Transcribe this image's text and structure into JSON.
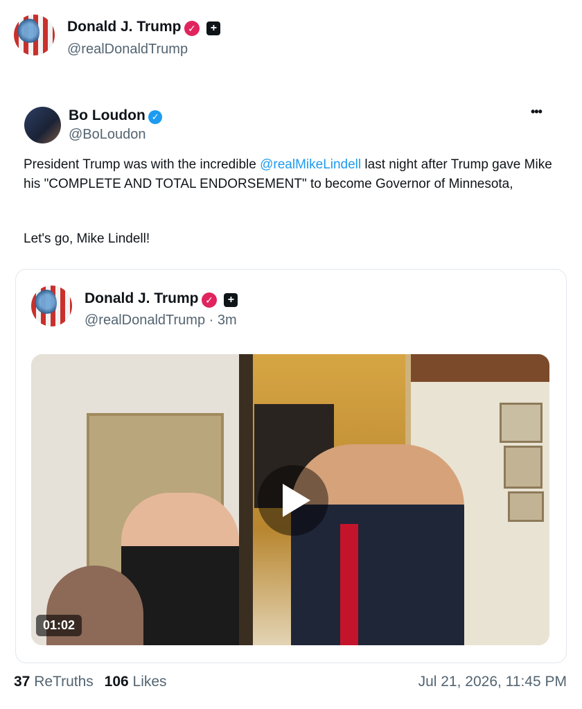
{
  "author": {
    "name": "Donald J. Trump",
    "handle": "@realDonaldTrump"
  },
  "retruth": {
    "name": "Bo Loudon",
    "handle": "@BoLoudon",
    "menu_icon": "•••",
    "text_before": "President Trump was with the incredible ",
    "mention": "@realMikeLindell",
    "text_after": " last night after Trump gave Mike his \"COMPLETE AND TOTAL ENDORSEMENT\" to become Governor of Minnesota,",
    "text_line2": "Let's go, Mike Lindell!"
  },
  "quoted": {
    "name": "Donald J. Trump",
    "handle_time": "@realDonaldTrump · 3m",
    "video_duration": "01:02"
  },
  "stats": {
    "retruths_count": "37",
    "retruths_label": "ReTruths",
    "likes_count": "106",
    "likes_label": "Likes",
    "timestamp": "Jul 21, 2026, 11:45 PM"
  },
  "colors": {
    "verified_badge": "#e0245e",
    "verified_badge_blue": "#1d9bf0",
    "mention": "#1d9bf0"
  }
}
